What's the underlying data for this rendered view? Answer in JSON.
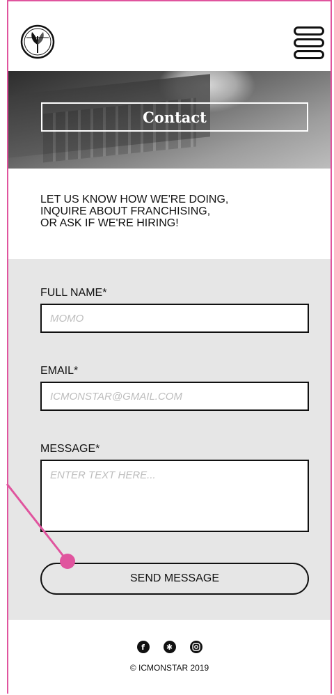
{
  "hero": {
    "title": "Contact"
  },
  "intro": {
    "lines": [
      "LET US KNOW HOW WE'RE DOING,",
      "INQUIRE ABOUT FRANCHISING,",
      "OR ASK IF WE'RE HIRING!"
    ]
  },
  "form": {
    "full_name": {
      "label": "FULL NAME*",
      "placeholder": "MOMO"
    },
    "email": {
      "label": "EMAIL*",
      "placeholder": "ICMONSTAR@GMAIL.COM"
    },
    "message": {
      "label": "MESSAGE*",
      "placeholder": "ENTER TEXT HERE..."
    },
    "send_label": "SEND MESSAGE"
  },
  "footer": {
    "social_icons": [
      "facebook-icon",
      "yelp-icon",
      "instagram-icon"
    ],
    "copyright": "© ICMONSTAR 2019"
  },
  "colors": {
    "annotation": "#e0549e",
    "form_background": "#e6e6e6",
    "text": "#111111"
  }
}
